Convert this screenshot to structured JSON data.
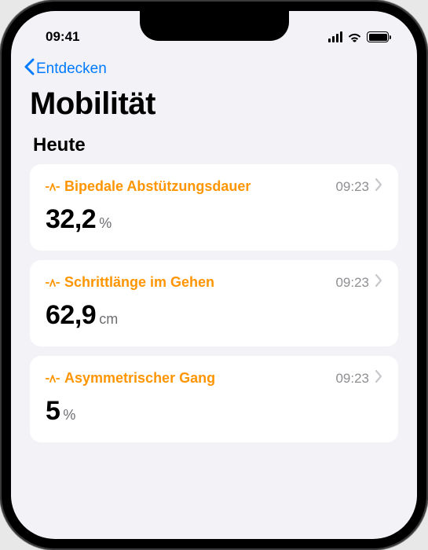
{
  "status": {
    "time": "09:41"
  },
  "nav": {
    "back_label": "Entdecken"
  },
  "page": {
    "title": "Mobilität"
  },
  "section": {
    "title": "Heute"
  },
  "cards": [
    {
      "title": "Bipedale Abstützungsdauer",
      "time": "09:23",
      "value": "32,2",
      "unit": "%"
    },
    {
      "title": "Schrittlänge im Gehen",
      "time": "09:23",
      "value": "62,9",
      "unit": "cm"
    },
    {
      "title": "Asymmetrischer Gang",
      "time": "09:23",
      "value": "5",
      "unit": "%"
    }
  ]
}
